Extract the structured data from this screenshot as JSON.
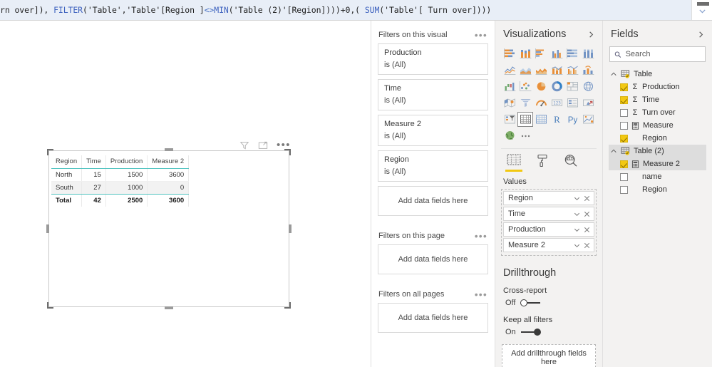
{
  "formula_bar": {
    "segments": [
      {
        "t": "rn over]), ",
        "c": "plain"
      },
      {
        "t": "FILTER",
        "c": "fn"
      },
      {
        "t": "('Table','Table'[Region ]",
        "c": "plain"
      },
      {
        "t": "<>",
        "c": "op"
      },
      {
        "t": "MIN",
        "c": "fn"
      },
      {
        "t": "('Table (2)'[Region])))+0,( ",
        "c": "plain"
      },
      {
        "t": "SUM",
        "c": "fn"
      },
      {
        "t": "('Table'[ Turn over])))",
        "c": "plain"
      }
    ],
    "full_text": "rn over]), FILTER('Table','Table'[Region ]<>MIN('Table (2)'[Region])))+0,( SUM('Table'[ Turn over])))",
    "expand_icon": "chevron-down-icon"
  },
  "canvas": {
    "visual_header_icons": [
      "filter-icon",
      "focus-mode-icon",
      "more-options-icon"
    ],
    "table_visual": {
      "columns": [
        {
          "label": "Region",
          "align": "left"
        },
        {
          "label": "Time",
          "align": "right"
        },
        {
          "label": "Production",
          "align": "right"
        },
        {
          "label": "Measure 2",
          "align": "right"
        }
      ],
      "rows": [
        {
          "cells": [
            "North",
            "15",
            "1500",
            "3600"
          ],
          "alt": false
        },
        {
          "cells": [
            "South",
            "27",
            "1000",
            "0"
          ],
          "alt": true
        }
      ],
      "total_row": {
        "cells": [
          "Total",
          "42",
          "2500",
          "3600"
        ]
      },
      "accent_color": "#4fc3c0"
    }
  },
  "filters_pane": {
    "sections": [
      {
        "title": "Filters on this visual",
        "cards": [
          {
            "name": "Production",
            "value": "is (All)"
          },
          {
            "name": "Time",
            "value": "is (All)"
          },
          {
            "name": "Measure 2",
            "value": "is (All)"
          },
          {
            "name": "Region",
            "value": "is (All)"
          }
        ],
        "dropzone": "Add data fields here"
      },
      {
        "title": "Filters on this page",
        "cards": [],
        "dropzone": "Add data fields here"
      },
      {
        "title": "Filters on all pages",
        "cards": [],
        "dropzone": "Add data fields here"
      }
    ]
  },
  "visualizations_pane": {
    "title": "Visualizations",
    "collapse_icon": "chevron-right-icon",
    "gallery": [
      "stacked-bar-chart-icon",
      "stacked-column-chart-icon",
      "clustered-bar-chart-icon",
      "clustered-column-chart-icon",
      "100-stacked-bar-chart-icon",
      "100-stacked-column-chart-icon",
      "line-chart-icon",
      "area-chart-icon",
      "stacked-area-chart-icon",
      "line-stacked-column-chart-icon",
      "line-clustered-column-chart-icon",
      "ribbon-chart-icon",
      "waterfall-chart-icon",
      "scatter-chart-icon",
      "pie-chart-icon",
      "donut-chart-icon",
      "treemap-icon",
      "map-icon",
      "filled-map-icon",
      "funnel-icon",
      "gauge-icon",
      "card-icon",
      "multi-row-card-icon",
      "kpi-icon",
      "slicer-icon",
      "table-icon",
      "matrix-icon",
      "r-script-visual-icon",
      "py-script-visual-icon",
      "key-influencers-icon",
      "arcgis-map-icon",
      "more-visuals-icon"
    ],
    "selected_gallery_index": 25,
    "tabs": [
      {
        "icon": "fields-tab-icon",
        "active": true
      },
      {
        "icon": "format-paint-roller-icon",
        "active": false
      },
      {
        "icon": "analytics-magnifier-icon",
        "active": false
      }
    ],
    "well_label": "Values",
    "well_items": [
      {
        "name": "Region"
      },
      {
        "name": "Time"
      },
      {
        "name": "Production"
      },
      {
        "name": "Measure 2"
      }
    ],
    "well_item_icons": [
      "chevron-down-icon",
      "remove-field-icon"
    ],
    "drillthrough": {
      "title": "Drillthrough",
      "cross_report": {
        "label": "Cross-report",
        "state": "Off",
        "on": false
      },
      "keep_all_filters": {
        "label": "Keep all filters",
        "state": "On",
        "on": true
      },
      "dropzone": "Add drillthrough fields here"
    }
  },
  "fields_pane": {
    "title": "Fields",
    "collapse_icon": "chevron-right-icon",
    "search": {
      "placeholder": "Search",
      "value": "",
      "icon": "search-icon"
    },
    "tables": [
      {
        "name": "Table",
        "expanded": true,
        "expand_icon": "chevron-up-icon",
        "table_icon": "table-entity-icon",
        "selected": false,
        "fields": [
          {
            "label": "Production",
            "checked": true,
            "kind": "sum",
            "selected": false
          },
          {
            "label": "Time",
            "checked": true,
            "kind": "sum",
            "selected": false
          },
          {
            "label": "Turn over",
            "checked": false,
            "kind": "sum",
            "selected": false
          },
          {
            "label": "Measure",
            "checked": false,
            "kind": "measure",
            "selected": false
          },
          {
            "label": "Region",
            "checked": true,
            "kind": "none",
            "selected": false
          }
        ]
      },
      {
        "name": "Table (2)",
        "expanded": true,
        "expand_icon": "chevron-up-icon",
        "table_icon": "table-entity-icon",
        "selected": true,
        "fields": [
          {
            "label": "Measure 2",
            "checked": true,
            "kind": "measure",
            "selected": true
          },
          {
            "label": "name",
            "checked": false,
            "kind": "none",
            "selected": false
          },
          {
            "label": "Region",
            "checked": false,
            "kind": "none",
            "selected": false
          }
        ]
      }
    ]
  },
  "colors": {
    "accent_yellow": "#f2c811",
    "table_accent": "#4fc3c0",
    "pane_background": "#f3f2f1",
    "formula_highlight": "#e8eef7"
  }
}
